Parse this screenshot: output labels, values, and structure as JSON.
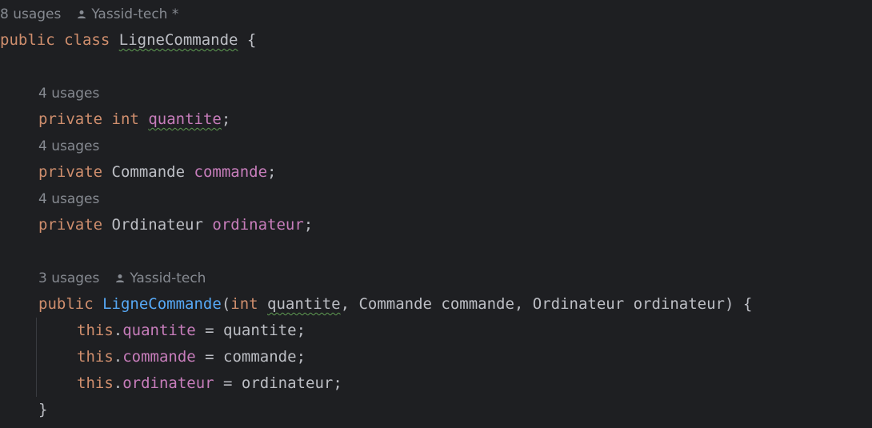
{
  "code_hints": {
    "class_usages": "8 usages",
    "class_author": "Yassid-tech *",
    "quantite_usages": "4 usages",
    "commande_usages": "4 usages",
    "ordinateur_usages": "4 usages",
    "ctor_usages": "3 usages",
    "ctor_author": "Yassid-tech"
  },
  "code": {
    "class_decl": {
      "kw_public": "public",
      "kw_class": "class",
      "class_name": "LigneCommande",
      "brace_open": " {"
    },
    "field_quantite": {
      "kw_private": "private",
      "kw_type": "int",
      "name": "quantite",
      "semi": ";"
    },
    "field_commande": {
      "kw_private": "private",
      "type": "Commande",
      "name": "commande",
      "semi": ";"
    },
    "field_ordinateur": {
      "kw_private": "private",
      "type": "Ordinateur",
      "name": "ordinateur",
      "semi": ";"
    },
    "ctor_decl": {
      "kw_public": "public",
      "name": "LigneCommande",
      "paren_open": "(",
      "kw_int": "int",
      "param_quantite": "quantite",
      "rest": ", Commande commande, Ordinateur ordinateur) {"
    },
    "assign_quantite": {
      "kw_this": "this",
      "dot": ".",
      "field": "quantite",
      "rhs": " = quantite;"
    },
    "assign_commande": {
      "kw_this": "this",
      "dot": ".",
      "field": "commande",
      "rhs": " = commande;"
    },
    "assign_ordinateur": {
      "kw_this": "this",
      "dot": ".",
      "field": "ordinateur",
      "rhs": " = ordinateur;"
    },
    "ctor_close": "}"
  },
  "colors": {
    "background": "#1e1f22",
    "keyword": "#cf8e6d",
    "field": "#c77dbb",
    "method": "#56a8f5",
    "text": "#bcbec4",
    "hint": "#868a91"
  }
}
